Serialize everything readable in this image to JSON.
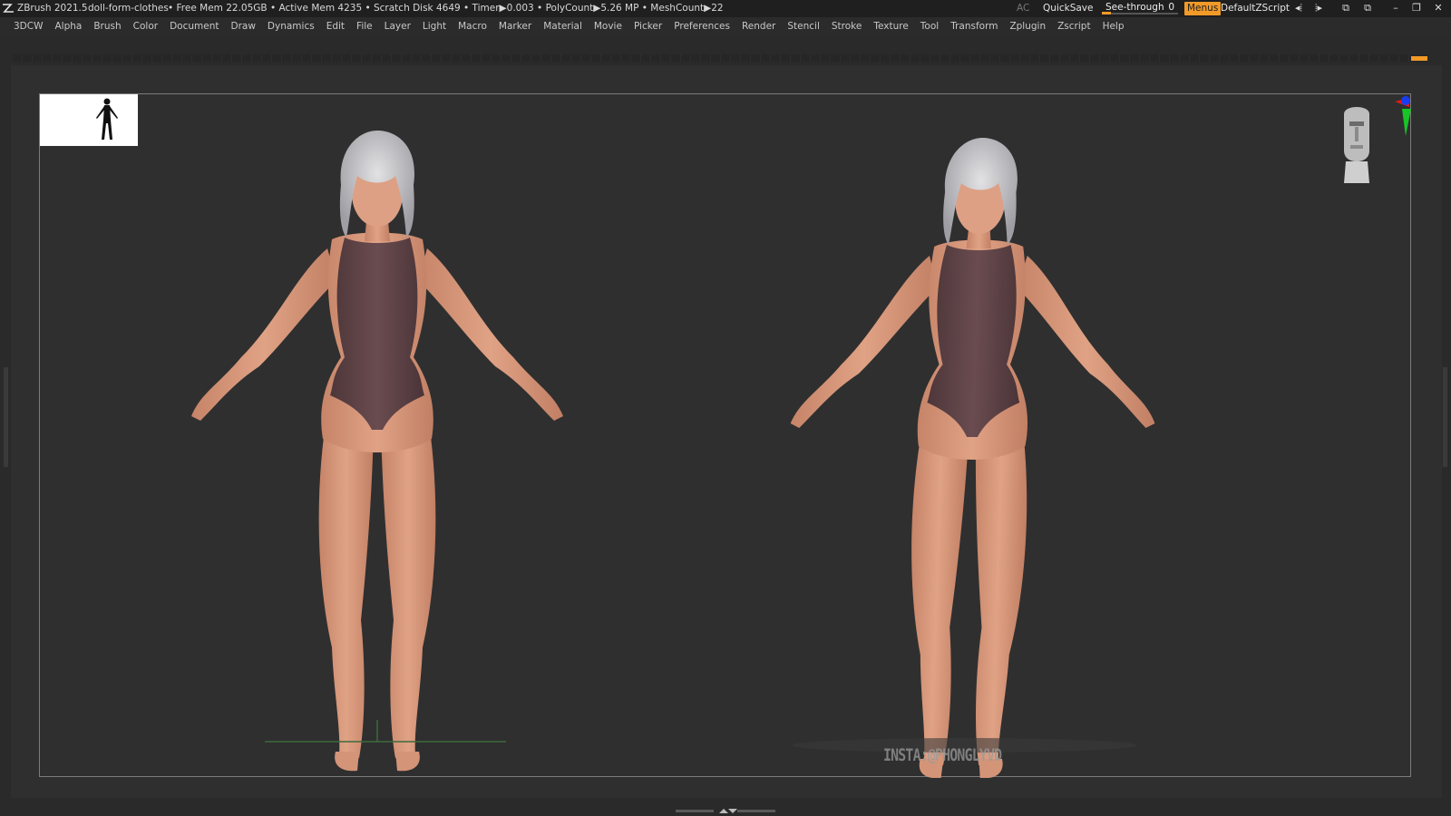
{
  "titlebar": {
    "app": "ZBrush 2021.5",
    "document": "doll-form-clothes",
    "stats": "• Free Mem 22.05GB • Active Mem 4235 • Scratch Disk 4649 • Timer▶0.003 • PolyCount▶5.26 MP • MeshCount▶22",
    "ac": "AC",
    "quicksave": "QuickSave",
    "seethrough_label": "See-through",
    "seethrough_value": "0",
    "seethrough_level": 0.0,
    "menus": "Menus",
    "default_zscript": "DefaultZScript"
  },
  "menu": [
    "3DCW",
    "Alpha",
    "Brush",
    "Color",
    "Document",
    "Draw",
    "Dynamics",
    "Edit",
    "File",
    "Layer",
    "Light",
    "Macro",
    "Marker",
    "Material",
    "Movie",
    "Picker",
    "Preferences",
    "Render",
    "Stencil",
    "Stroke",
    "Texture",
    "Tool",
    "Transform",
    "Zplugin",
    "Zscript",
    "Help"
  ],
  "viewport": {
    "watermark": "INSTA:@PHONGLYVD"
  },
  "colors": {
    "accent": "#f19a28",
    "skin": "#d9977a",
    "suit": "#5e4347",
    "hair": "#c8c8cc",
    "axis_x": "#e31919",
    "axis_y": "#18c526",
    "axis_z": "#1a3cf0"
  },
  "icons": [
    "zbrush-logo-icon",
    "layout-icon",
    "minimize-icon",
    "restore-icon",
    "close-icon",
    "axis-gizmo-icon",
    "head-navigator-icon"
  ]
}
